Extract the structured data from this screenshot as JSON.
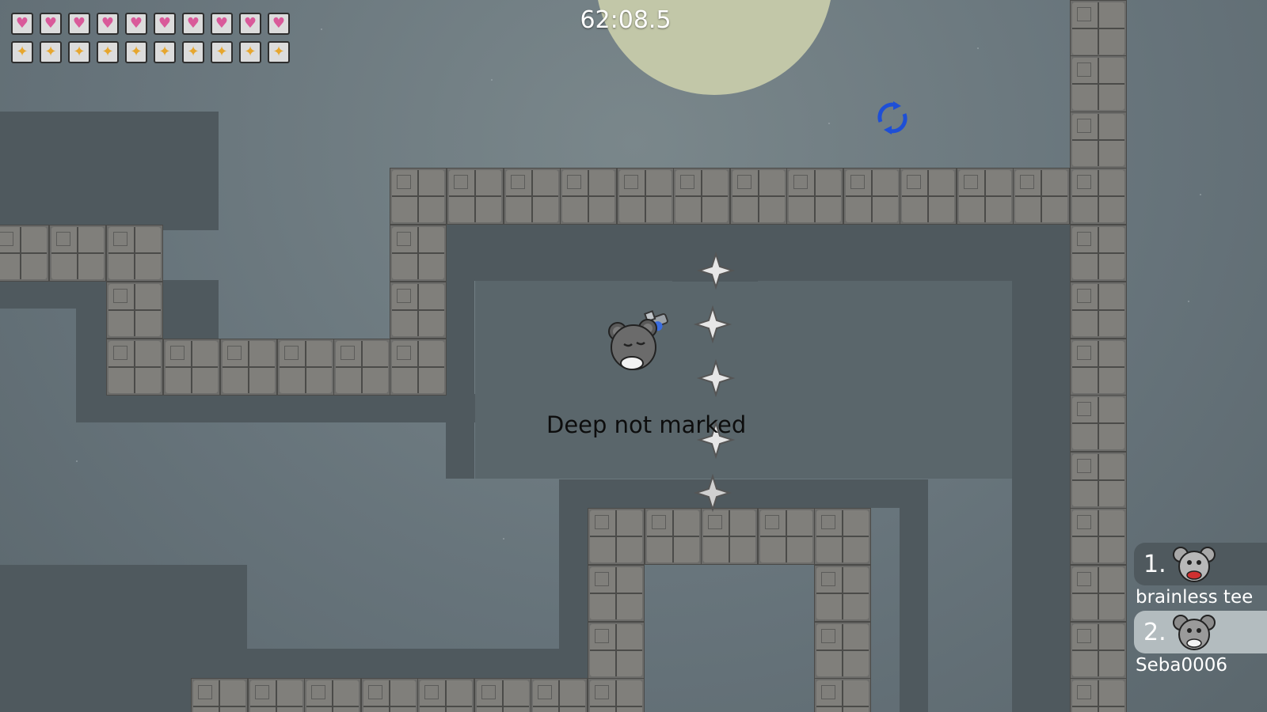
{
  "hud": {
    "timer": "62:08.5",
    "health": [
      "heart-icon",
      "heart-icon",
      "heart-icon",
      "heart-icon",
      "heart-icon",
      "heart-icon",
      "heart-icon",
      "heart-icon",
      "heart-icon",
      "heart-icon"
    ],
    "armor": [
      "armor-icon",
      "armor-icon",
      "armor-icon",
      "armor-icon",
      "armor-icon",
      "armor-icon",
      "armor-icon",
      "armor-icon",
      "armor-icon",
      "armor-icon"
    ]
  },
  "world": {
    "tile_label": "Deep not marked"
  },
  "scoreboard": {
    "players": [
      {
        "rank": "1.",
        "name": "brainless tee",
        "skin": "mouse-skin-red"
      },
      {
        "rank": "2.",
        "name": "Seba0006",
        "skin": "mouse-skin-grey"
      }
    ]
  },
  "colors": {
    "sky": "#6b787d",
    "moon": "#c2c7a8",
    "heart": "#d95a9a",
    "armor": "#e6a62e",
    "pickup_arrow": "#1e4fd6"
  }
}
